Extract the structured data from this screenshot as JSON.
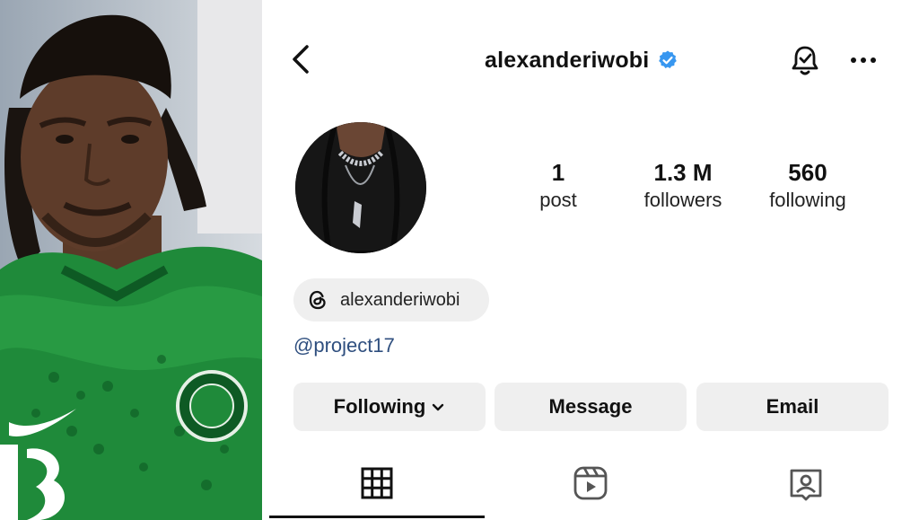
{
  "header": {
    "username": "alexanderiwobi",
    "verified": true,
    "back_icon": "chevron-left-icon",
    "bell_icon": "bell-check-icon",
    "more_icon": "more-horizontal-icon"
  },
  "stats": [
    {
      "value": "1",
      "label": "post"
    },
    {
      "value": "1.3 M",
      "label": "followers"
    },
    {
      "value": "560",
      "label": "following"
    }
  ],
  "threads": {
    "icon": "threads-icon",
    "handle": "alexanderiwobi"
  },
  "bio": {
    "link": "@project17"
  },
  "actions": {
    "following": "Following",
    "message": "Message",
    "email": "Email"
  },
  "tabs": [
    {
      "icon": "grid-icon",
      "active": true
    },
    {
      "icon": "reels-icon",
      "active": false
    },
    {
      "icon": "tagged-icon",
      "active": false
    }
  ],
  "colors": {
    "verified": "#3897f0",
    "link": "#2f4f7f",
    "button_bg": "#efefef",
    "jersey": "#1f8a3a"
  }
}
